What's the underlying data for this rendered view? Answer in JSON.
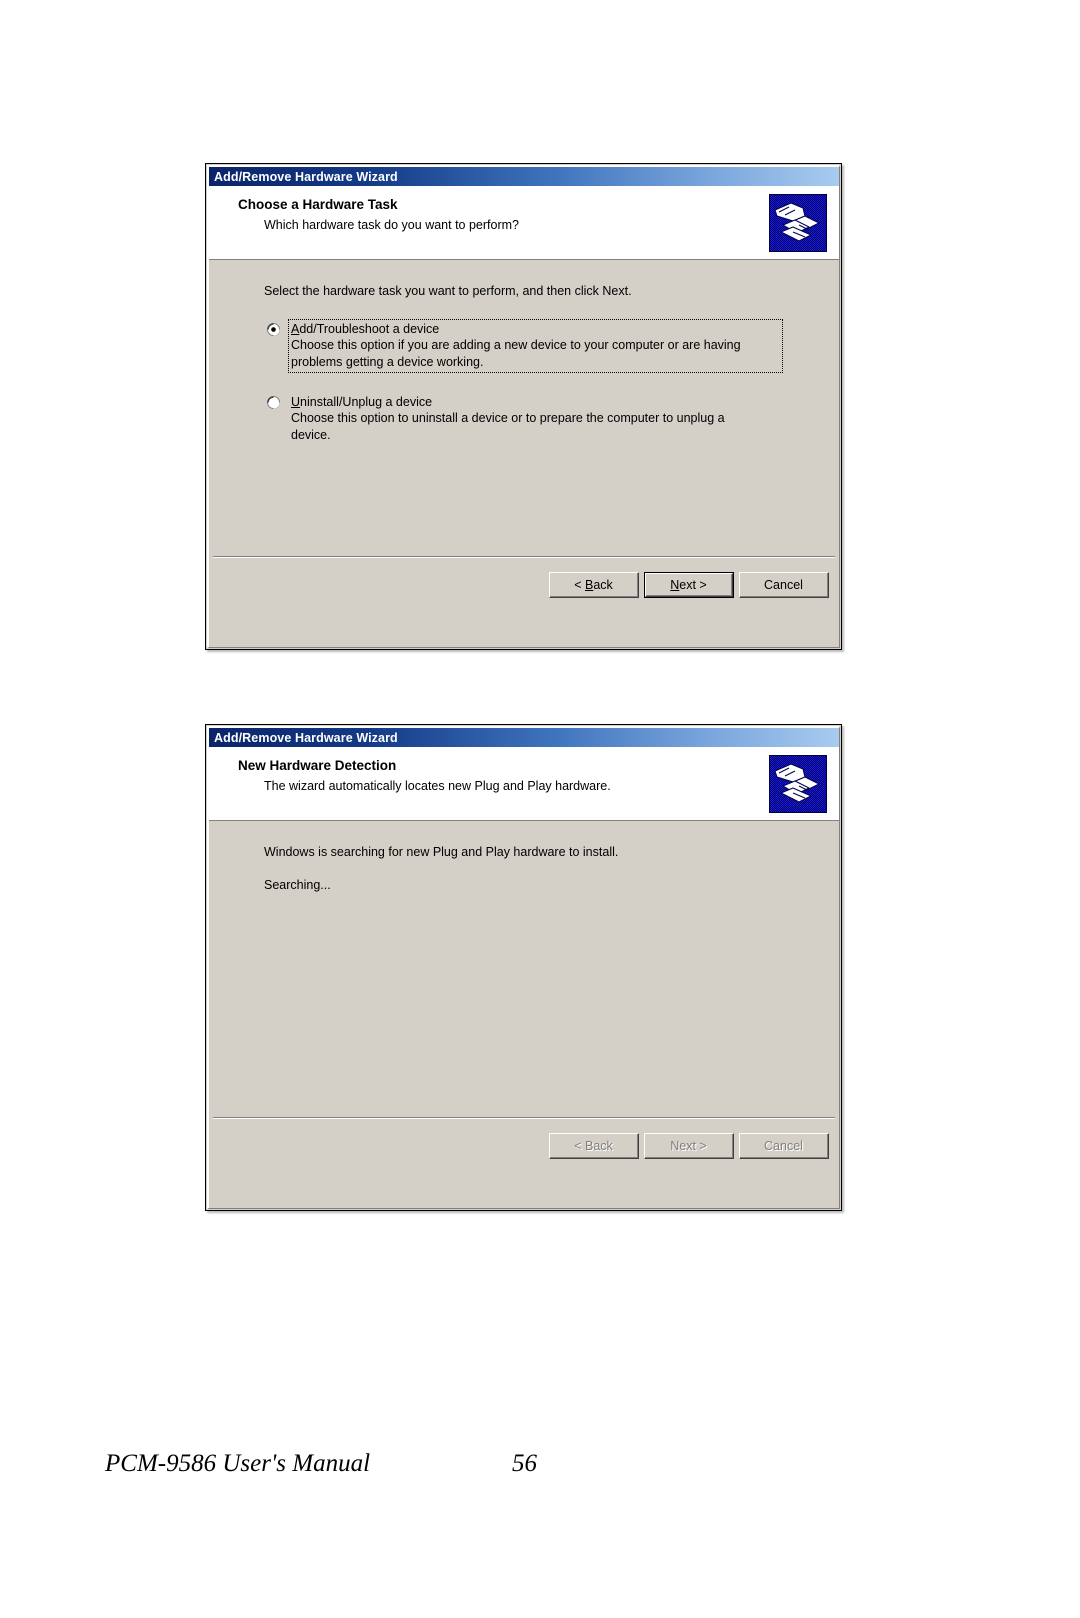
{
  "document": {
    "footer": {
      "manual_title": "PCM-9586 User's Manual",
      "page_number": "56"
    }
  },
  "dialogs": [
    {
      "name": "choose-a-hardware-task",
      "titlebar": "Add/Remove Hardware Wizard",
      "header_title": "Choose a Hardware Task",
      "header_subtitle": "Which hardware task do you want to perform?",
      "icon": "hardware-wizard-icon",
      "intro": "Select the hardware task you want to perform, and then click Next.",
      "options": [
        {
          "label_prefix": "",
          "label_mnemonic": "A",
          "label_rest": "dd/Troubleshoot a device",
          "label_full": "Add/Troubleshoot a device",
          "description": "Choose this option if you are adding a new device to your computer or are having problems getting a device working.",
          "selected": true,
          "focused": true
        },
        {
          "label_prefix": "",
          "label_mnemonic": "U",
          "label_rest": "ninstall/Unplug a device",
          "label_full": "Uninstall/Unplug a device",
          "description": "Choose this option to uninstall a device or to prepare the computer to unplug a device.",
          "selected": false,
          "focused": false
        }
      ],
      "buttons": [
        {
          "name": "back-button",
          "prefix": "< ",
          "mnemonic": "B",
          "rest": "ack",
          "default": false,
          "disabled": false
        },
        {
          "name": "next-button",
          "prefix": "",
          "mnemonic": "N",
          "rest": "ext >",
          "default": true,
          "disabled": false
        },
        {
          "name": "cancel-button",
          "prefix": "",
          "mnemonic": "",
          "rest": "Cancel",
          "default": false,
          "disabled": false
        }
      ]
    },
    {
      "name": "new-hardware-detection",
      "titlebar": "Add/Remove Hardware Wizard",
      "header_title": "New Hardware Detection",
      "header_subtitle": "The wizard automatically locates new Plug and Play hardware.",
      "icon": "hardware-wizard-icon",
      "status_lines": [
        "Windows is searching for new Plug and Play hardware to install.",
        "Searching..."
      ],
      "buttons": [
        {
          "name": "back-button",
          "prefix": "< ",
          "mnemonic": "",
          "rest": "Back",
          "default": false,
          "disabled": true
        },
        {
          "name": "next-button",
          "prefix": "",
          "mnemonic": "",
          "rest": "Next >",
          "default": false,
          "disabled": true
        },
        {
          "name": "cancel-button",
          "prefix": "",
          "mnemonic": "",
          "rest": "Cancel",
          "default": false,
          "disabled": true
        }
      ]
    }
  ],
  "colors": {
    "dialog_face": "#d4d0c8",
    "titlebar_start": "#0a246a",
    "titlebar_end": "#a8cbef",
    "icon_background": "#00008b",
    "text": "#000000",
    "disabled_text": "#808080"
  }
}
